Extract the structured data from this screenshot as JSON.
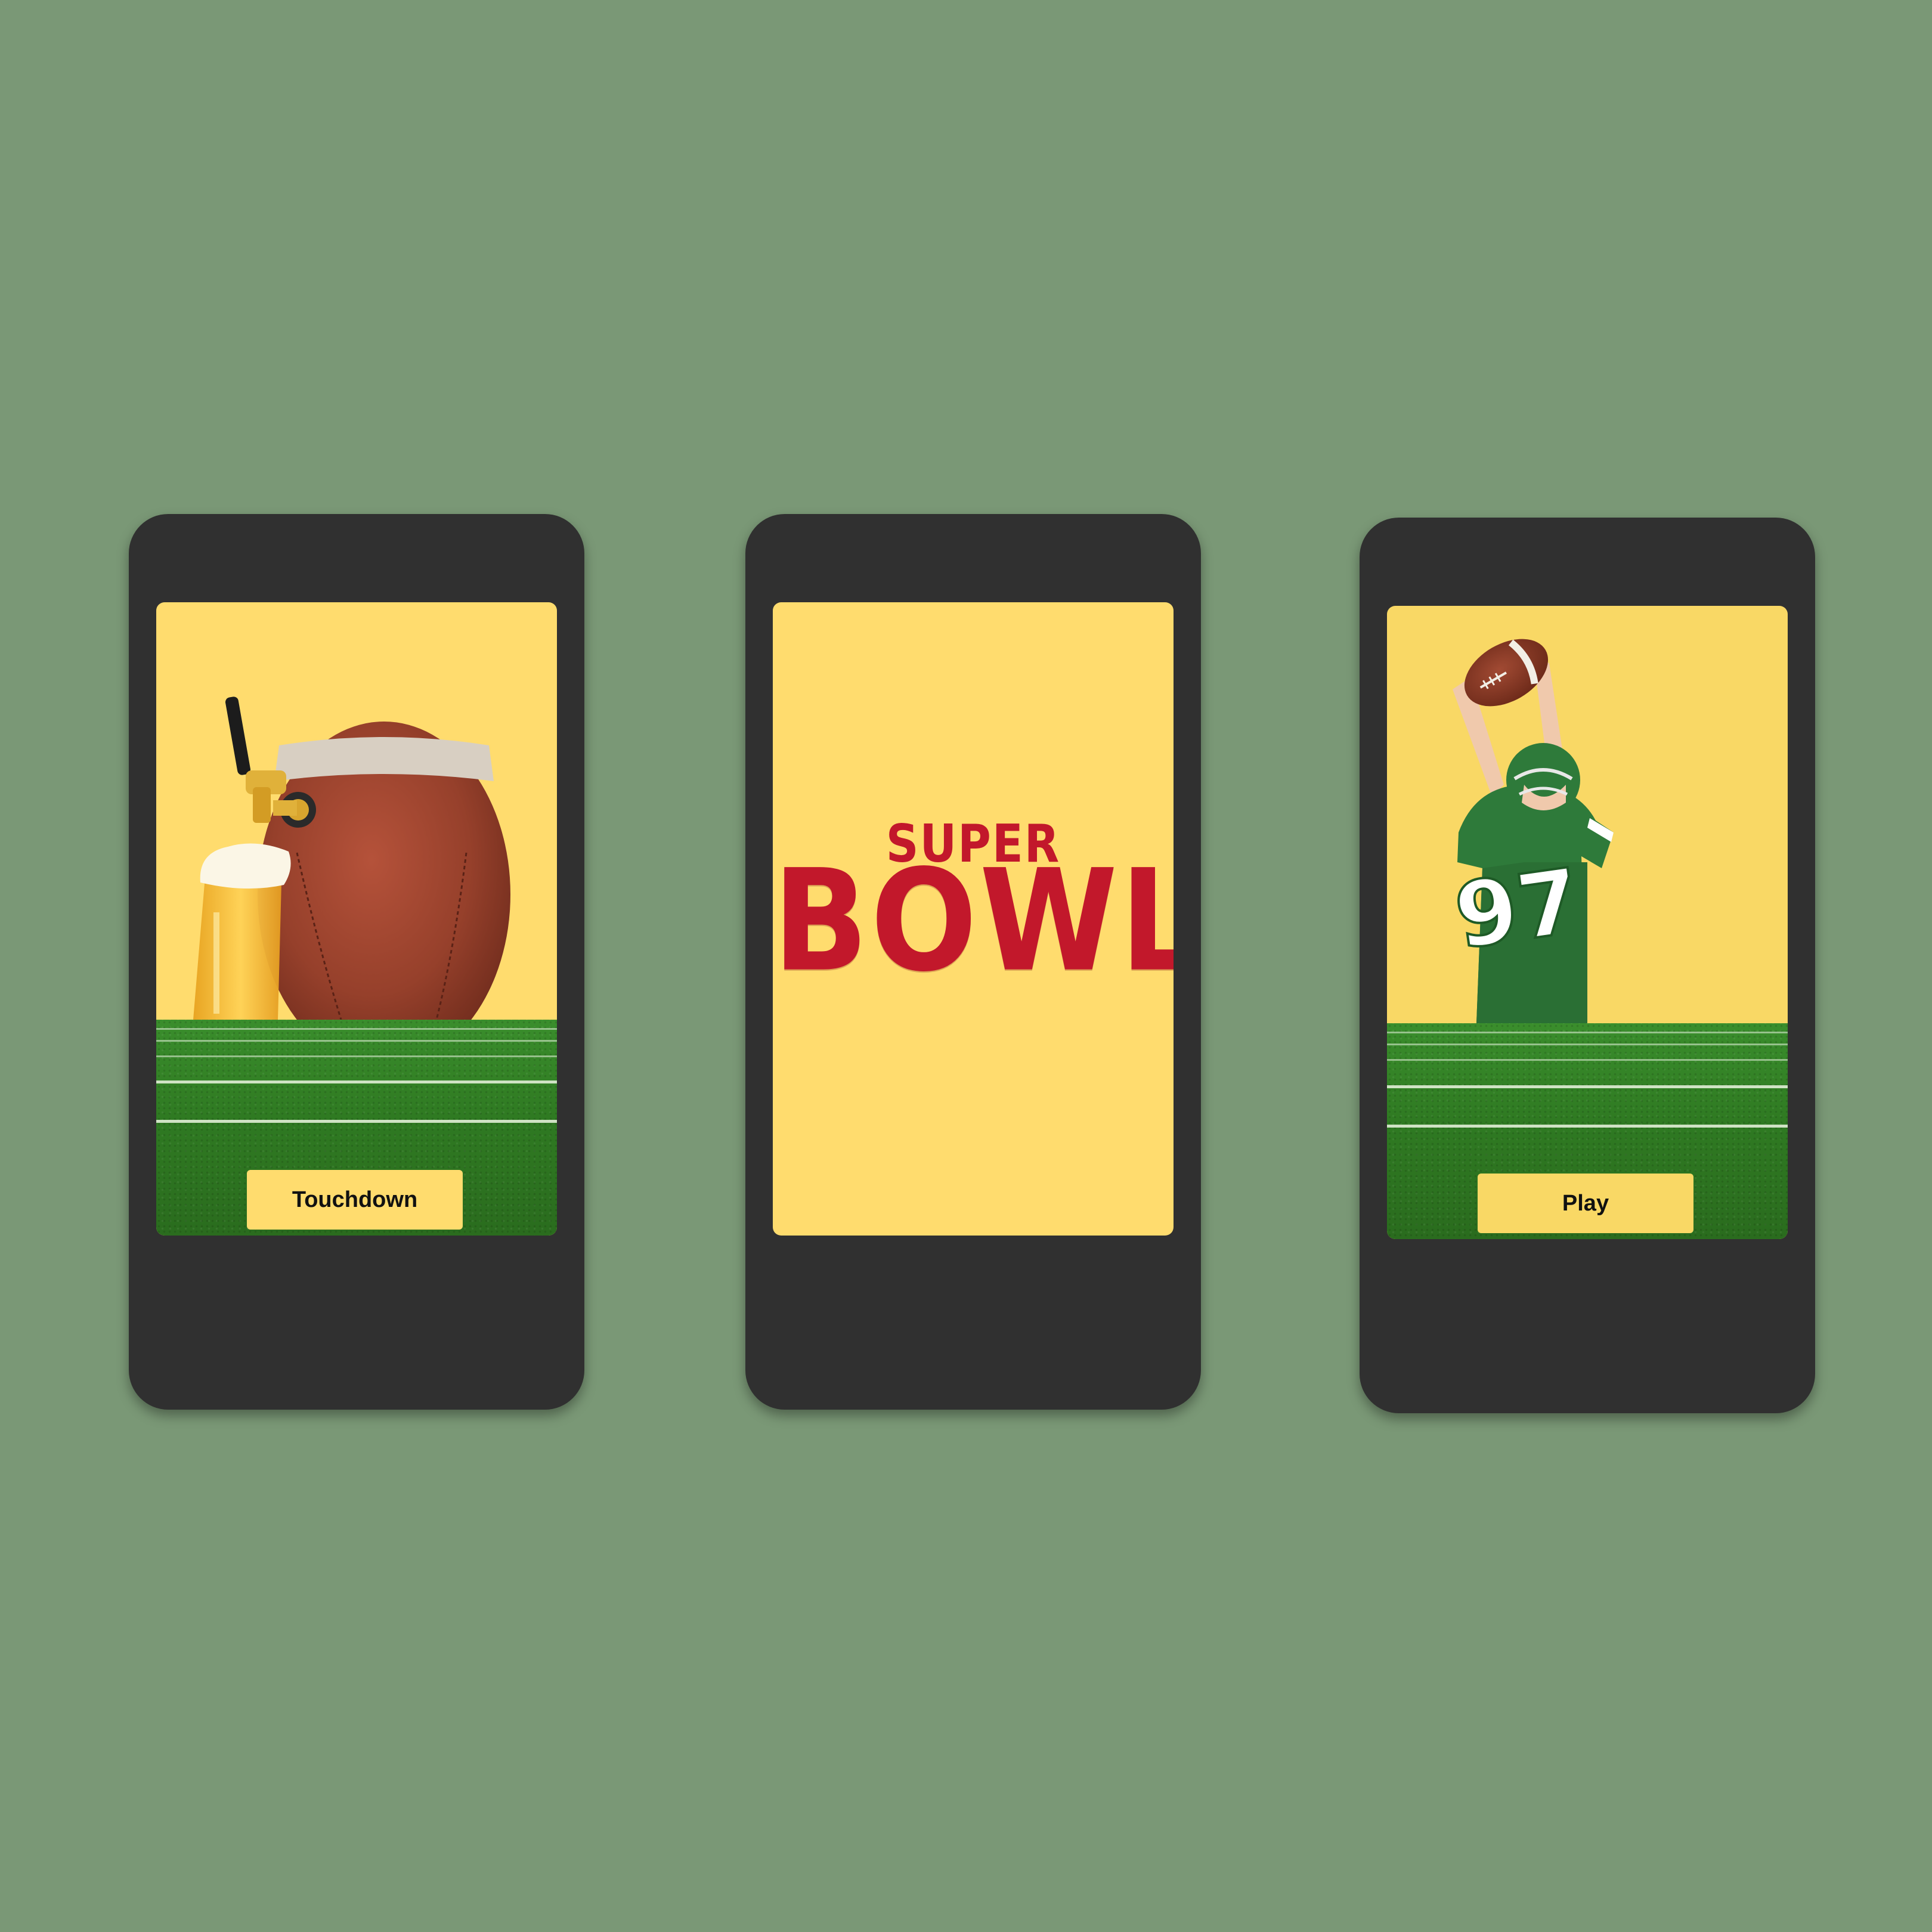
{
  "screens": [
    {
      "id": "touchdown-screen",
      "button_label": "Touchdown"
    },
    {
      "id": "splash-screen",
      "logo_top": "SUPER",
      "logo_bottom": "BOWL"
    },
    {
      "id": "play-screen",
      "button_label": "Play",
      "jersey_number": "97"
    }
  ],
  "colors": {
    "background": "#7a9876",
    "phone_frame": "#303030",
    "screen_yellow": "#ffdc6e",
    "logo_red": "#c2182b",
    "field_green": "#2f7a22"
  },
  "icons": [
    "beer-tap-icon",
    "beer-glass-icon",
    "football-icon",
    "football-player-icon"
  ]
}
